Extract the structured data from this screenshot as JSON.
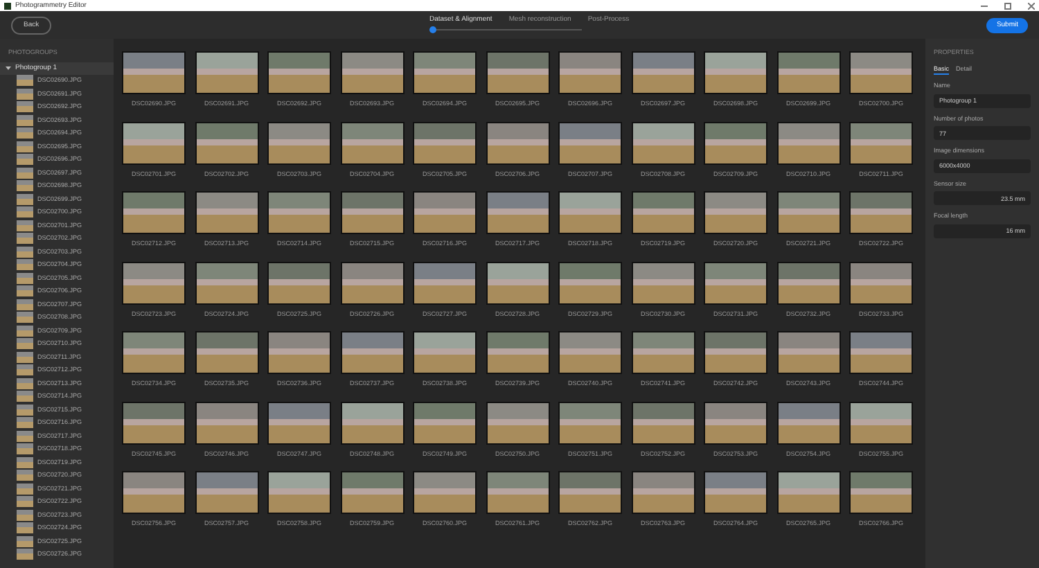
{
  "window": {
    "title": "Photogrammetry Editor"
  },
  "header": {
    "back": "Back",
    "submit": "Submit",
    "steps": [
      {
        "label": "Dataset & Alignment",
        "selected": true
      },
      {
        "label": "Mesh reconstruction",
        "selected": false
      },
      {
        "label": "Post-Process",
        "selected": false
      }
    ]
  },
  "sidebar": {
    "title": "PHOTOGROUPS",
    "group": {
      "label": "Photogroup 1",
      "expanded": true,
      "items": [
        "DSC02690.JPG",
        "DSC02691.JPG",
        "DSC02692.JPG",
        "DSC02693.JPG",
        "DSC02694.JPG",
        "DSC02695.JPG",
        "DSC02696.JPG",
        "DSC02697.JPG",
        "DSC02698.JPG",
        "DSC02699.JPG",
        "DSC02700.JPG",
        "DSC02701.JPG",
        "DSC02702.JPG",
        "DSC02703.JPG",
        "DSC02704.JPG",
        "DSC02705.JPG",
        "DSC02706.JPG",
        "DSC02707.JPG",
        "DSC02708.JPG",
        "DSC02709.JPG",
        "DSC02710.JPG",
        "DSC02711.JPG",
        "DSC02712.JPG",
        "DSC02713.JPG",
        "DSC02714.JPG",
        "DSC02715.JPG",
        "DSC02716.JPG",
        "DSC02717.JPG",
        "DSC02718.JPG",
        "DSC02719.JPG",
        "DSC02720.JPG",
        "DSC02721.JPG",
        "DSC02722.JPG",
        "DSC02723.JPG",
        "DSC02724.JPG",
        "DSC02725.JPG",
        "DSC02726.JPG"
      ]
    }
  },
  "gallery": {
    "rows": [
      [
        "DSC02690.JPG",
        "DSC02691.JPG",
        "DSC02692.JPG",
        "DSC02693.JPG",
        "DSC02694.JPG",
        "DSC02695.JPG",
        "DSC02696.JPG",
        "DSC02697.JPG",
        "DSC02698.JPG",
        "DSC02699.JPG",
        "DSC02700.JPG"
      ],
      [
        "DSC02701.JPG",
        "DSC02702.JPG",
        "DSC02703.JPG",
        "DSC02704.JPG",
        "DSC02705.JPG",
        "DSC02706.JPG",
        "DSC02707.JPG",
        "DSC02708.JPG",
        "DSC02709.JPG",
        "DSC02710.JPG",
        "DSC02711.JPG"
      ],
      [
        "DSC02712.JPG",
        "DSC02713.JPG",
        "DSC02714.JPG",
        "DSC02715.JPG",
        "DSC02716.JPG",
        "DSC02717.JPG",
        "DSC02718.JPG",
        "DSC02719.JPG",
        "DSC02720.JPG",
        "DSC02721.JPG",
        "DSC02722.JPG"
      ],
      [
        "DSC02723.JPG",
        "DSC02724.JPG",
        "DSC02725.JPG",
        "DSC02726.JPG",
        "DSC02727.JPG",
        "DSC02728.JPG",
        "DSC02729.JPG",
        "DSC02730.JPG",
        "DSC02731.JPG",
        "DSC02732.JPG",
        "DSC02733.JPG"
      ],
      [
        "DSC02734.JPG",
        "DSC02735.JPG",
        "DSC02736.JPG",
        "DSC02737.JPG",
        "DSC02738.JPG",
        "DSC02739.JPG",
        "DSC02740.JPG",
        "DSC02741.JPG",
        "DSC02742.JPG",
        "DSC02743.JPG",
        "DSC02744.JPG"
      ],
      [
        "DSC02745.JPG",
        "DSC02746.JPG",
        "DSC02747.JPG",
        "DSC02748.JPG",
        "DSC02749.JPG",
        "DSC02750.JPG",
        "DSC02751.JPG",
        "DSC02752.JPG",
        "DSC02753.JPG",
        "DSC02754.JPG",
        "DSC02755.JPG"
      ],
      [
        "DSC02756.JPG",
        "DSC02757.JPG",
        "DSC02758.JPG",
        "DSC02759.JPG",
        "DSC02760.JPG",
        "DSC02761.JPG",
        "DSC02762.JPG",
        "DSC02763.JPG",
        "DSC02764.JPG",
        "DSC02765.JPG",
        "DSC02766.JPG"
      ]
    ]
  },
  "properties": {
    "title": "PROPERTIES",
    "tabs": [
      {
        "label": "Basic",
        "selected": true
      },
      {
        "label": "Detail",
        "selected": false
      }
    ],
    "fields": [
      {
        "label": "Name",
        "value": "Photogroup 1",
        "kind": "text"
      },
      {
        "label": "Number of photos",
        "value": "77",
        "kind": "text"
      },
      {
        "label": "Image dimensions",
        "value": "6000x4000",
        "kind": "text"
      },
      {
        "label": "Sensor size",
        "value": "23.5 mm",
        "kind": "measure"
      },
      {
        "label": "Focal length",
        "value": "16 mm",
        "kind": "measure"
      }
    ]
  }
}
